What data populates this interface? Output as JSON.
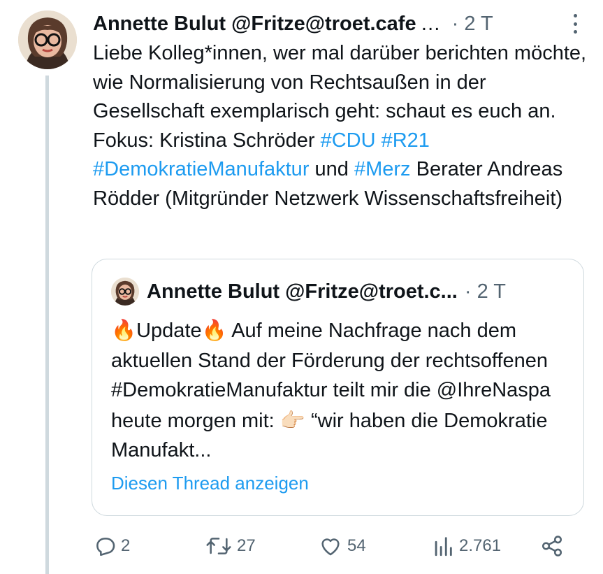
{
  "post": {
    "author_name": "Annette Bulut",
    "author_handle": "@Fritze@troet.cafe",
    "header_ellipsis": "…",
    "time": "· 2 T",
    "text_parts": {
      "t1": "Liebe Kolleg*innen, wer mal darüber berichten möchte, wie Normalisierung von Rechtsaußen in der Gesellschaft exemplarisch geht: schaut es euch an. Fokus: Kristina Schröder ",
      "tag_cdu": "#CDU",
      "tag_r21": "#R21",
      "tag_dm": "#DemokratieManufaktur",
      "t2": " und ",
      "tag_merz": "#Merz",
      "t3": " Berater Andreas Rödder (Mitgründer Netzwerk Wissenschaftsfreiheit)"
    }
  },
  "quote": {
    "author_name": "Annette Bulut",
    "author_handle": "@Fritze@troet.c...",
    "time": "· 2 T",
    "text_parts": {
      "fire1": "🔥",
      "update": "Update",
      "fire2": "🔥",
      "t1": " Auf meine Nachfrage nach dem aktuellen Stand der Förderung der rechtsoffenen #DemokratieManufaktur teilt mir die @IhreNaspa heute morgen mit:",
      "finger": "👉🏻",
      "t2": " “wir haben die Demokratie Manufakt..."
    },
    "show_thread": "Diesen Thread anzeigen"
  },
  "actions": {
    "replies": "2",
    "reposts": "27",
    "likes": "54",
    "views": "2.761"
  },
  "colors": {
    "link": "#1d9bf0",
    "muted": "#536471",
    "border": "#cfd9de",
    "text": "#0f1419"
  }
}
